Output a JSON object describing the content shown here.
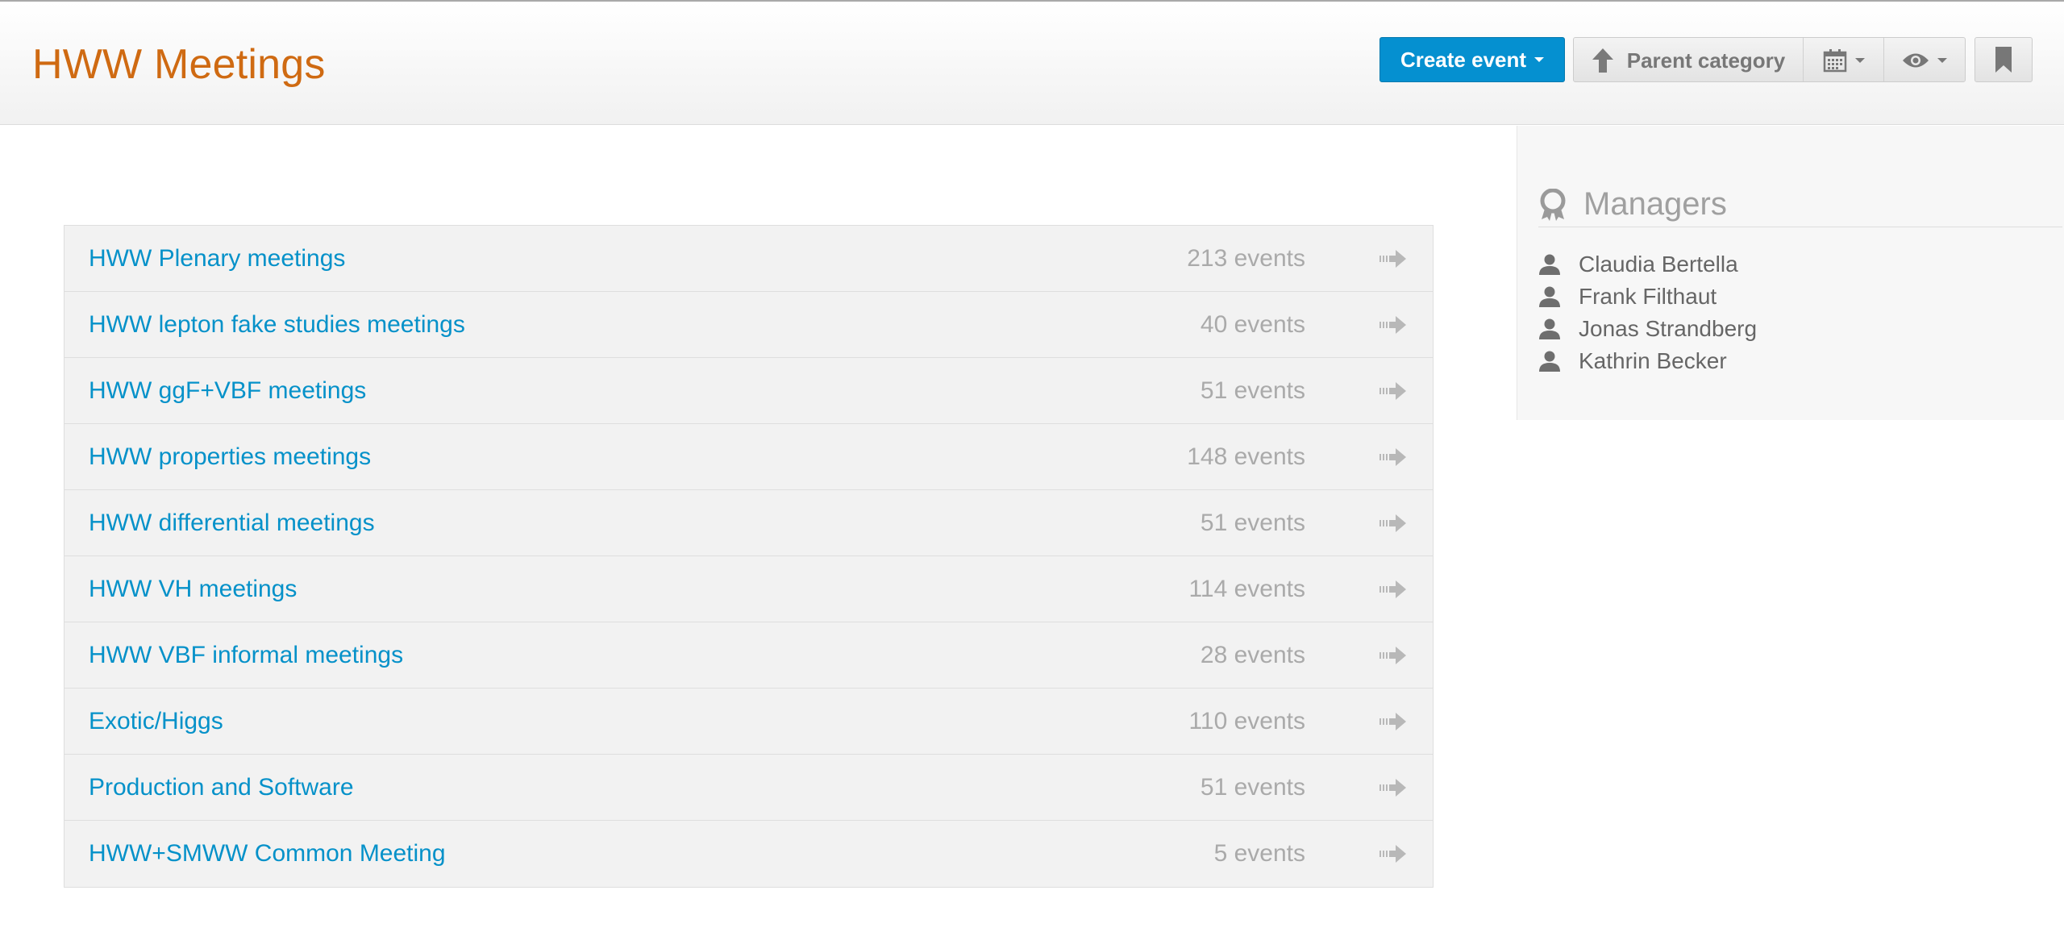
{
  "header": {
    "title": "HWW Meetings",
    "create_event_label": "Create event",
    "parent_category_label": "Parent category",
    "icons": [
      "up-arrow-icon",
      "calendar-icon",
      "eye-icon",
      "bookmark-icon"
    ]
  },
  "categories": [
    {
      "name": "HWW Plenary meetings",
      "count": "213 events"
    },
    {
      "name": "HWW lepton fake studies meetings",
      "count": "40 events"
    },
    {
      "name": "HWW ggF+VBF meetings",
      "count": "51 events"
    },
    {
      "name": "HWW properties meetings",
      "count": "148 events"
    },
    {
      "name": "HWW differential meetings",
      "count": "51 events"
    },
    {
      "name": "HWW VH meetings",
      "count": "114 events"
    },
    {
      "name": "HWW VBF informal meetings",
      "count": "28 events"
    },
    {
      "name": "Exotic/Higgs",
      "count": "110 events"
    },
    {
      "name": "Production and Software",
      "count": "51 events"
    },
    {
      "name": "HWW+SMWW Common Meeting",
      "count": "5 events"
    }
  ],
  "managers": {
    "title": "Managers",
    "people": [
      "Claudia Bertella",
      "Frank Filthaut",
      "Jonas Strandberg",
      "Kathrin Becker"
    ]
  },
  "colors": {
    "title": "#cf6a12",
    "link": "#0591c9",
    "primary_button": "#0590d0",
    "count": "#aaaaaa"
  }
}
